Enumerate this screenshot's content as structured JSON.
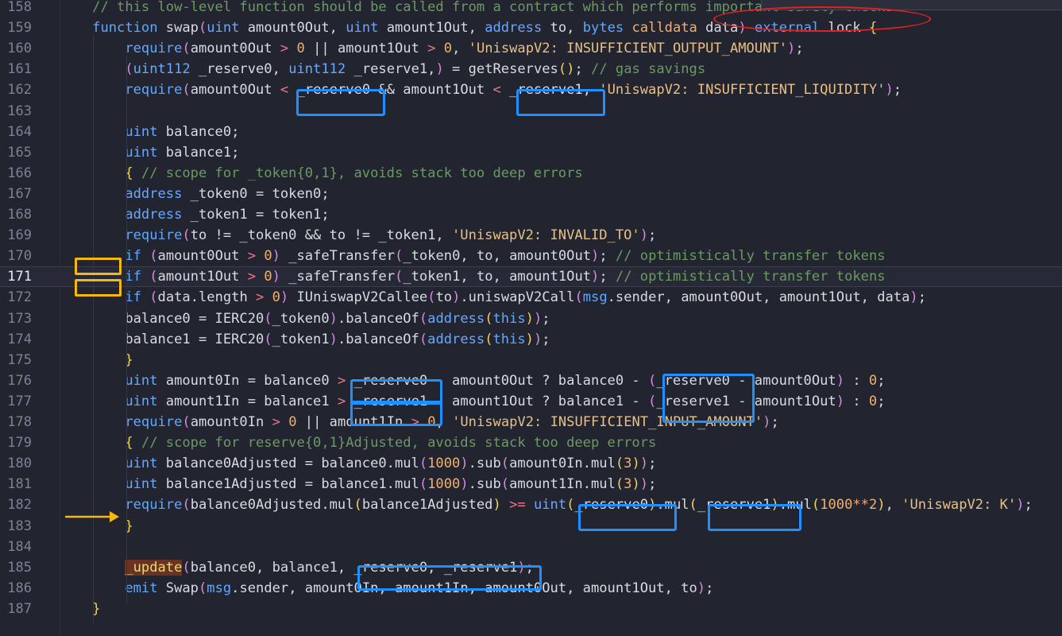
{
  "editor": {
    "lines": [
      {
        "n": "158",
        "segs": [
          [
            "    ",
            ""
          ],
          [
            "// this low-level function should be called from a contract which performs important safety checks",
            "cm"
          ]
        ]
      },
      {
        "n": "159",
        "segs": [
          [
            "    ",
            ""
          ],
          [
            "function",
            "kw"
          ],
          [
            " swap",
            "id"
          ],
          [
            "(",
            "par"
          ],
          [
            "uint",
            "ty"
          ],
          [
            " amount0Out, ",
            "id"
          ],
          [
            "uint",
            "ty"
          ],
          [
            " amount1Out, ",
            "id"
          ],
          [
            "address",
            "ty"
          ],
          [
            " to, ",
            "id"
          ],
          [
            "bytes",
            "kw"
          ],
          [
            " ",
            ""
          ],
          [
            "calldata",
            "num"
          ],
          [
            " data",
            "id"
          ],
          [
            ")",
            "par"
          ],
          [
            " ",
            ""
          ],
          [
            "external",
            "kw"
          ],
          [
            " lock ",
            "id"
          ],
          [
            "{",
            "br"
          ]
        ]
      },
      {
        "n": "160",
        "segs": [
          [
            "        ",
            ""
          ],
          [
            "require",
            "kw"
          ],
          [
            "(",
            "par"
          ],
          [
            "amount0Out ",
            "id"
          ],
          [
            ">",
            "op"
          ],
          [
            " ",
            ""
          ],
          [
            "0",
            "num"
          ],
          [
            " || amount1Out ",
            "id"
          ],
          [
            ">",
            "op"
          ],
          [
            " ",
            ""
          ],
          [
            "0",
            "num"
          ],
          [
            ", ",
            "id"
          ],
          [
            "'UniswapV2: INSUFFICIENT_OUTPUT_AMOUNT'",
            "str"
          ],
          [
            ")",
            "par"
          ],
          [
            ";",
            "id"
          ]
        ]
      },
      {
        "n": "161",
        "segs": [
          [
            "        ",
            ""
          ],
          [
            "(",
            "par"
          ],
          [
            "uint112",
            "ty"
          ],
          [
            " _reserve0, ",
            "id"
          ],
          [
            "uint112",
            "ty"
          ],
          [
            " _reserve1,",
            "id"
          ],
          [
            ")",
            "par"
          ],
          [
            " = getReserves",
            "id"
          ],
          [
            "()",
            "br"
          ],
          [
            "; ",
            "id"
          ],
          [
            "// gas savings",
            "cm"
          ]
        ]
      },
      {
        "n": "162",
        "segs": [
          [
            "        ",
            ""
          ],
          [
            "require",
            "kw"
          ],
          [
            "(",
            "par"
          ],
          [
            "amount0Out ",
            "id"
          ],
          [
            "<",
            "op"
          ],
          [
            " _reserve0 && amount1Out ",
            "id"
          ],
          [
            "<",
            "op"
          ],
          [
            " _reserve1, ",
            "id"
          ],
          [
            "'UniswapV2: INSUFFICIENT_LIQUIDITY'",
            "str"
          ],
          [
            ")",
            "par"
          ],
          [
            ";",
            "id"
          ]
        ]
      },
      {
        "n": "163",
        "segs": []
      },
      {
        "n": "164",
        "segs": [
          [
            "        ",
            ""
          ],
          [
            "uint",
            "ty"
          ],
          [
            " balance0;",
            "id"
          ]
        ]
      },
      {
        "n": "165",
        "segs": [
          [
            "        ",
            ""
          ],
          [
            "uint",
            "ty"
          ],
          [
            " balance1;",
            "id"
          ]
        ]
      },
      {
        "n": "166",
        "segs": [
          [
            "        ",
            ""
          ],
          [
            "{",
            "br"
          ],
          [
            " ",
            ""
          ],
          [
            "// scope for _token{0,1}, avoids stack too deep errors",
            "cm"
          ]
        ]
      },
      {
        "n": "167",
        "segs": [
          [
            "        ",
            ""
          ],
          [
            "address",
            "ty"
          ],
          [
            " _token0 = token0;",
            "id"
          ]
        ]
      },
      {
        "n": "168",
        "segs": [
          [
            "        ",
            ""
          ],
          [
            "address",
            "ty"
          ],
          [
            " _token1 = token1;",
            "id"
          ]
        ]
      },
      {
        "n": "169",
        "segs": [
          [
            "        ",
            ""
          ],
          [
            "require",
            "kw"
          ],
          [
            "(",
            "par"
          ],
          [
            "to != _token0 && to != _token1, ",
            "id"
          ],
          [
            "'UniswapV2: INVALID_TO'",
            "str"
          ],
          [
            ")",
            "par"
          ],
          [
            ";",
            "id"
          ]
        ]
      },
      {
        "n": "170",
        "segs": [
          [
            "        ",
            ""
          ],
          [
            "if",
            "kw"
          ],
          [
            " ",
            ""
          ],
          [
            "(",
            "par"
          ],
          [
            "amount0Out ",
            "id"
          ],
          [
            ">",
            "op"
          ],
          [
            " ",
            ""
          ],
          [
            "0",
            "num"
          ],
          [
            ")",
            "par"
          ],
          [
            " _safeTransfer",
            "id"
          ],
          [
            "(",
            "par"
          ],
          [
            "_token0, to, amount0Out",
            "id"
          ],
          [
            ")",
            "par"
          ],
          [
            "; ",
            "id"
          ],
          [
            "// optimistically transfer tokens",
            "cm"
          ]
        ]
      },
      {
        "n": "171",
        "cur": true,
        "segs": [
          [
            "        ",
            ""
          ],
          [
            "if",
            "kw"
          ],
          [
            " ",
            ""
          ],
          [
            "(",
            "par"
          ],
          [
            "amount1Out ",
            "id"
          ],
          [
            ">",
            "op"
          ],
          [
            " ",
            ""
          ],
          [
            "0",
            "num"
          ],
          [
            ")",
            "par"
          ],
          [
            " _safeTransfer",
            "id"
          ],
          [
            "(",
            "par"
          ],
          [
            "_token1, to, amount1Out",
            "id"
          ],
          [
            ")",
            "par"
          ],
          [
            "; ",
            "id"
          ],
          [
            "// optimistically transfer tokens",
            "cm"
          ]
        ]
      },
      {
        "n": "172",
        "segs": [
          [
            "        ",
            ""
          ],
          [
            "if",
            "kw"
          ],
          [
            " ",
            ""
          ],
          [
            "(",
            "par"
          ],
          [
            "data.length ",
            "id"
          ],
          [
            ">",
            "op"
          ],
          [
            " ",
            ""
          ],
          [
            "0",
            "num"
          ],
          [
            ")",
            "par"
          ],
          [
            " IUniswapV2Callee",
            "id"
          ],
          [
            "(",
            "par"
          ],
          [
            "to",
            "id"
          ],
          [
            ")",
            "par"
          ],
          [
            ".uniswapV2Call",
            "id"
          ],
          [
            "(",
            "par"
          ],
          [
            "msg",
            "kw"
          ],
          [
            ".sender, amount0Out, amount1Out, data",
            "id"
          ],
          [
            ")",
            "par"
          ],
          [
            ";",
            "id"
          ]
        ]
      },
      {
        "n": "173",
        "segs": [
          [
            "        ",
            ""
          ],
          [
            "balance0 = IERC20",
            "id"
          ],
          [
            "(",
            "par"
          ],
          [
            "_token0",
            "id"
          ],
          [
            ")",
            "par"
          ],
          [
            ".balanceOf",
            "id"
          ],
          [
            "(",
            "par"
          ],
          [
            "address",
            "ty"
          ],
          [
            "(",
            "br"
          ],
          [
            "this",
            "kw"
          ],
          [
            ")",
            "br"
          ],
          [
            ")",
            "par"
          ],
          [
            ";",
            "id"
          ]
        ]
      },
      {
        "n": "174",
        "segs": [
          [
            "        ",
            ""
          ],
          [
            "balance1 = IERC20",
            "id"
          ],
          [
            "(",
            "par"
          ],
          [
            "_token1",
            "id"
          ],
          [
            ")",
            "par"
          ],
          [
            ".balanceOf",
            "id"
          ],
          [
            "(",
            "par"
          ],
          [
            "address",
            "ty"
          ],
          [
            "(",
            "br"
          ],
          [
            "this",
            "kw"
          ],
          [
            ")",
            "br"
          ],
          [
            ")",
            "par"
          ],
          [
            ";",
            "id"
          ]
        ]
      },
      {
        "n": "175",
        "segs": [
          [
            "        ",
            ""
          ],
          [
            "}",
            "br"
          ]
        ]
      },
      {
        "n": "176",
        "segs": [
          [
            "        ",
            ""
          ],
          [
            "uint",
            "ty"
          ],
          [
            " amount0In = balance0 ",
            "id"
          ],
          [
            ">",
            "op"
          ],
          [
            " _reserve0 - amount0Out ? balance0 - ",
            "id"
          ],
          [
            "(",
            "par"
          ],
          [
            "_reserve0 - amount0Out",
            "id"
          ],
          [
            ")",
            "par"
          ],
          [
            " : ",
            "id"
          ],
          [
            "0",
            "num"
          ],
          [
            ";",
            "id"
          ]
        ]
      },
      {
        "n": "177",
        "segs": [
          [
            "        ",
            ""
          ],
          [
            "uint",
            "ty"
          ],
          [
            " amount1In = balance1 ",
            "id"
          ],
          [
            ">",
            "op"
          ],
          [
            " _reserve1 - amount1Out ? balance1 - ",
            "id"
          ],
          [
            "(",
            "par"
          ],
          [
            "_reserve1 - amount1Out",
            "id"
          ],
          [
            ")",
            "par"
          ],
          [
            " : ",
            "id"
          ],
          [
            "0",
            "num"
          ],
          [
            ";",
            "id"
          ]
        ]
      },
      {
        "n": "178",
        "segs": [
          [
            "        ",
            ""
          ],
          [
            "require",
            "kw"
          ],
          [
            "(",
            "par"
          ],
          [
            "amount0In ",
            "id"
          ],
          [
            ">",
            "op"
          ],
          [
            " ",
            ""
          ],
          [
            "0",
            "num"
          ],
          [
            " || amount1In ",
            "id"
          ],
          [
            ">",
            "op"
          ],
          [
            " ",
            ""
          ],
          [
            "0",
            "num"
          ],
          [
            ", ",
            "id"
          ],
          [
            "'UniswapV2: INSUFFICIENT_INPUT_AMOUNT'",
            "str"
          ],
          [
            ")",
            "par"
          ],
          [
            ";",
            "id"
          ]
        ]
      },
      {
        "n": "179",
        "segs": [
          [
            "        ",
            ""
          ],
          [
            "{",
            "br"
          ],
          [
            " ",
            ""
          ],
          [
            "// scope for reserve{0,1}Adjusted, avoids stack too deep errors",
            "cm"
          ]
        ]
      },
      {
        "n": "180",
        "segs": [
          [
            "        ",
            ""
          ],
          [
            "uint",
            "ty"
          ],
          [
            " balance0Adjusted = balance0.mul",
            "id"
          ],
          [
            "(",
            "par"
          ],
          [
            "1000",
            "num"
          ],
          [
            ")",
            "par"
          ],
          [
            ".sub",
            "id"
          ],
          [
            "(",
            "par"
          ],
          [
            "amount0In.mul",
            "id"
          ],
          [
            "(",
            "br"
          ],
          [
            "3",
            "num"
          ],
          [
            ")",
            "br"
          ],
          [
            ")",
            "par"
          ],
          [
            ";",
            "id"
          ]
        ]
      },
      {
        "n": "181",
        "segs": [
          [
            "        ",
            ""
          ],
          [
            "uint",
            "ty"
          ],
          [
            " balance1Adjusted = balance1.mul",
            "id"
          ],
          [
            "(",
            "par"
          ],
          [
            "1000",
            "num"
          ],
          [
            ")",
            "par"
          ],
          [
            ".sub",
            "id"
          ],
          [
            "(",
            "par"
          ],
          [
            "amount1In.mul",
            "id"
          ],
          [
            "(",
            "br"
          ],
          [
            "3",
            "num"
          ],
          [
            ")",
            "br"
          ],
          [
            ")",
            "par"
          ],
          [
            ";",
            "id"
          ]
        ]
      },
      {
        "n": "182",
        "segs": [
          [
            "        ",
            ""
          ],
          [
            "require",
            "kw"
          ],
          [
            "(",
            "par"
          ],
          [
            "balance0Adjusted.mul",
            "id"
          ],
          [
            "(",
            "br"
          ],
          [
            "balance1Adjusted",
            "id"
          ],
          [
            ")",
            "br"
          ],
          [
            " ",
            ""
          ],
          [
            ">=",
            "op"
          ],
          [
            " ",
            ""
          ],
          [
            "uint",
            "ty"
          ],
          [
            "(",
            "br"
          ],
          [
            "_reserve0",
            "id"
          ],
          [
            ")",
            "br"
          ],
          [
            ".mul",
            "id"
          ],
          [
            "(",
            "br"
          ],
          [
            "_reserve1",
            "id"
          ],
          [
            ")",
            "br"
          ],
          [
            ".mul",
            "id"
          ],
          [
            "(",
            "br"
          ],
          [
            "1000**2",
            "num"
          ],
          [
            ")",
            "br"
          ],
          [
            ", ",
            "id"
          ],
          [
            "'UniswapV2: K'",
            "str"
          ],
          [
            ")",
            "par"
          ],
          [
            ";",
            "id"
          ]
        ]
      },
      {
        "n": "183",
        "segs": [
          [
            "        ",
            ""
          ],
          [
            "}",
            "br"
          ]
        ]
      },
      {
        "n": "184",
        "segs": []
      },
      {
        "n": "185",
        "segs": [
          [
            "        ",
            ""
          ],
          [
            "_update",
            "yel hl-update"
          ],
          [
            "(",
            "par"
          ],
          [
            "balance0, balance1, _reserve0, _reserve1",
            "id"
          ],
          [
            ")",
            "par"
          ],
          [
            ";",
            "id"
          ]
        ]
      },
      {
        "n": "186",
        "segs": [
          [
            "        ",
            ""
          ],
          [
            "emit",
            "kw"
          ],
          [
            " Swap",
            "id"
          ],
          [
            "(",
            "par"
          ],
          [
            "msg",
            "kw"
          ],
          [
            ".sender, amount0In, amount1In, amount0Out, amount1Out, to",
            "id"
          ],
          [
            ")",
            "par"
          ],
          [
            ";",
            "id"
          ]
        ]
      },
      {
        "n": "187",
        "segs": [
          [
            "    ",
            ""
          ],
          [
            "}",
            "br"
          ]
        ]
      }
    ]
  },
  "colors": {
    "annotation_blue": "#1e90ff",
    "annotation_orange": "#f5b80f",
    "annotation_red": "#e02222"
  }
}
